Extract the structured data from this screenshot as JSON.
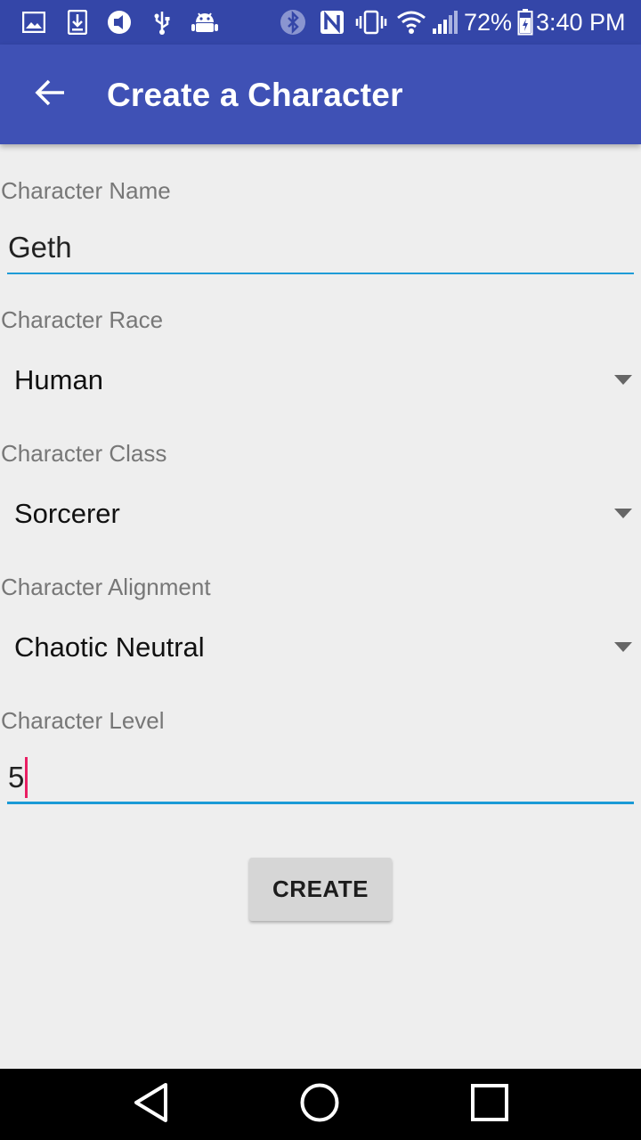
{
  "status_bar": {
    "battery_percent": "72%",
    "time": "3:40 PM",
    "icons": [
      "image-icon",
      "download-icon",
      "sync-icon",
      "usb-icon",
      "android-debug-icon",
      "bluetooth-icon",
      "nfc-icon",
      "vibrate-icon",
      "wifi-icon",
      "signal-icon",
      "battery-icon"
    ]
  },
  "app_bar": {
    "title": "Create a Character",
    "back_icon": "arrow-back-icon"
  },
  "form": {
    "name": {
      "label": "Character Name",
      "value": "Geth"
    },
    "race": {
      "label": "Character Race",
      "value": "Human"
    },
    "class": {
      "label": "Character Class",
      "value": "Sorcerer"
    },
    "alignment": {
      "label": "Character Alignment",
      "value": "Chaotic Neutral"
    },
    "level": {
      "label": "Character Level",
      "value": "5"
    },
    "create_label": "CREATE"
  },
  "nav_bar": {
    "buttons": [
      "back-triangle-icon",
      "home-circle-icon",
      "recents-square-icon"
    ]
  },
  "colors": {
    "status_bar": "#3446a8",
    "app_bar": "#3f51b5",
    "accent_underline": "#1e9bd7",
    "cursor": "#e91e63",
    "background": "#eeeeee"
  }
}
